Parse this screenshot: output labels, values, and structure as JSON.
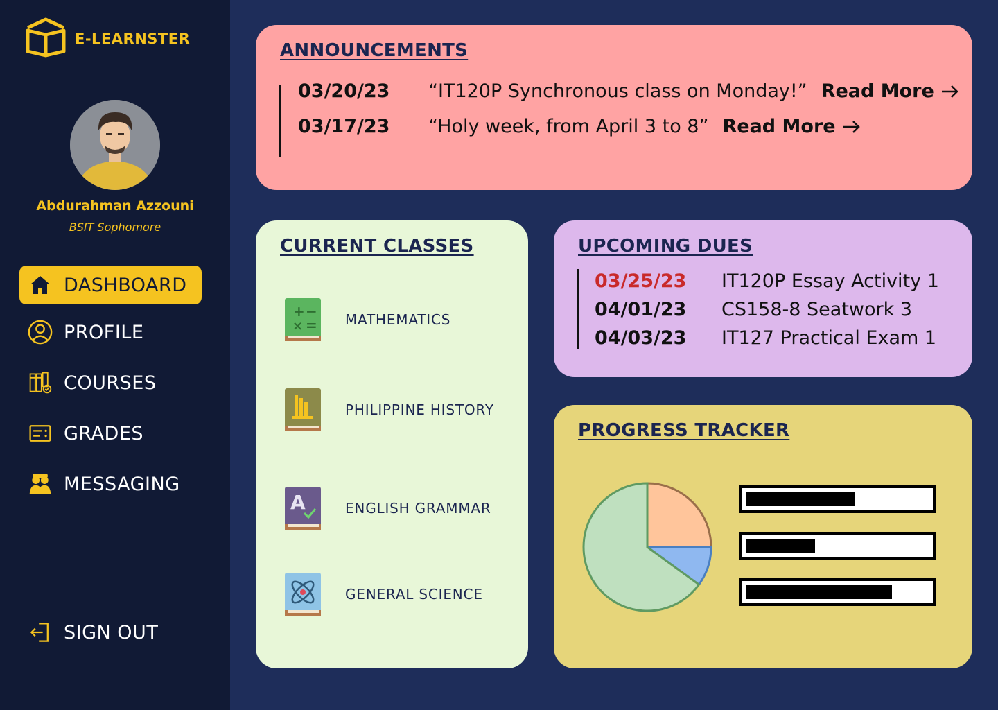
{
  "brand": {
    "name": "E-LEARNSTER",
    "color": "#f5c320"
  },
  "user": {
    "name": "Abdurahman Azzouni",
    "role": "BSIT Sophomore"
  },
  "nav": {
    "items": [
      {
        "label": "DASHBOARD",
        "icon": "home-icon",
        "active": true
      },
      {
        "label": "PROFILE",
        "icon": "user-circle-icon"
      },
      {
        "label": "COURSES",
        "icon": "books-icon"
      },
      {
        "label": "GRADES",
        "icon": "grades-card-icon"
      },
      {
        "label": "MESSAGING",
        "icon": "people-icon"
      }
    ],
    "signout": {
      "label": "SIGN OUT",
      "icon": "sign-out-icon"
    }
  },
  "announcements": {
    "title": "ANNOUNCEMENTS",
    "items": [
      {
        "date": "03/20/23",
        "text": "“IT120P Synchronous class on Monday!”",
        "link": "Read More"
      },
      {
        "date": "03/17/23",
        "text": "“Holy week, from April 3 to 8”",
        "link": "Read More"
      }
    ]
  },
  "classes": {
    "title": "CURRENT CLASSES",
    "items": [
      {
        "name": "MATHEMATICS",
        "icon": "math-book-icon"
      },
      {
        "name": "PHILIPPINE HISTORY",
        "icon": "history-book-icon"
      },
      {
        "name": "ENGLISH GRAMMAR",
        "icon": "grammar-book-icon"
      },
      {
        "name": "GENERAL SCIENCE",
        "icon": "science-book-icon"
      }
    ]
  },
  "dues": {
    "title": "UPCOMING DUES",
    "items": [
      {
        "date": "03/25/23",
        "task": "IT120P Essay Activity 1",
        "urgent": true
      },
      {
        "date": "04/01/23",
        "task": "CS158-8 Seatwork 3"
      },
      {
        "date": "04/03/23",
        "task": "IT127 Practical Exam 1"
      }
    ]
  },
  "progress": {
    "title": "PROGRESS TRACKER",
    "pie_slices": [
      {
        "fraction": 0.25,
        "color": "#ffc59b"
      },
      {
        "fraction": 0.1,
        "color": "#8fb8f0"
      },
      {
        "fraction": 0.65,
        "color": "#bfe0bf"
      }
    ],
    "bars": [
      0.6,
      0.38,
      0.8
    ]
  }
}
